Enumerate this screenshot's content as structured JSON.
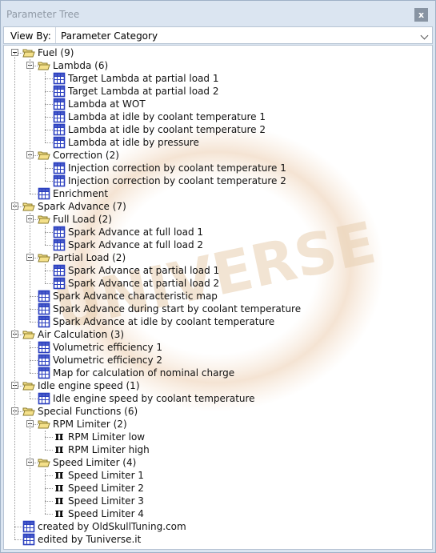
{
  "panel": {
    "title": "Parameter Tree",
    "close_label": "x"
  },
  "view_by": {
    "label": "View By:",
    "value": "Parameter Category"
  },
  "watermark_text": "UNIVERSE",
  "tree": [
    {
      "label": "Fuel (9)",
      "icon": "folder-open-icon",
      "expanded": true,
      "children": [
        {
          "label": "Lambda (6)",
          "icon": "folder-open-icon",
          "expanded": true,
          "children": [
            {
              "label": "Target Lambda at partial load 1",
              "icon": "table-icon"
            },
            {
              "label": "Target Lambda at partial load 2",
              "icon": "table-icon"
            },
            {
              "label": "Lambda at WOT",
              "icon": "table-icon"
            },
            {
              "label": "Lambda at idle by coolant temperature 1",
              "icon": "table-icon"
            },
            {
              "label": "Lambda at idle by coolant temperature 2",
              "icon": "table-icon"
            },
            {
              "label": "Lambda at idle by pressure",
              "icon": "table-icon"
            }
          ]
        },
        {
          "label": "Correction (2)",
          "icon": "folder-open-icon",
          "expanded": true,
          "children": [
            {
              "label": "Injection correction by coolant temperature 1",
              "icon": "table-icon"
            },
            {
              "label": "Injection correction by coolant temperature 2",
              "icon": "table-icon"
            }
          ]
        },
        {
          "label": "Enrichment",
          "icon": "table-icon"
        }
      ]
    },
    {
      "label": "Spark Advance (7)",
      "icon": "folder-open-icon",
      "expanded": true,
      "children": [
        {
          "label": "Full Load (2)",
          "icon": "folder-open-icon",
          "expanded": true,
          "children": [
            {
              "label": "Spark Advance at full load 1",
              "icon": "table-icon"
            },
            {
              "label": "Spark Advance at full load 2",
              "icon": "table-icon"
            }
          ]
        },
        {
          "label": "Partial Load (2)",
          "icon": "folder-open-icon",
          "expanded": true,
          "children": [
            {
              "label": "Spark Advance at partial load 1",
              "icon": "table-icon"
            },
            {
              "label": "Spark Advance at partial load 2",
              "icon": "table-icon"
            }
          ]
        },
        {
          "label": "Spark Advance characteristic map",
          "icon": "table-icon"
        },
        {
          "label": "Spark Advance during start by coolant temperature",
          "icon": "table-icon"
        },
        {
          "label": "Spark Advance at idle by coolant temperature",
          "icon": "table-icon"
        }
      ]
    },
    {
      "label": "Air Calculation (3)",
      "icon": "folder-open-icon",
      "expanded": true,
      "children": [
        {
          "label": "Volumetric efficiency 1",
          "icon": "table-icon"
        },
        {
          "label": "Volumetric efficiency 2",
          "icon": "table-icon"
        },
        {
          "label": "Map for calculation of nominal charge",
          "icon": "table-icon"
        }
      ]
    },
    {
      "label": "Idle engine speed (1)",
      "icon": "folder-open-icon",
      "expanded": true,
      "children": [
        {
          "label": "Idle engine speed by coolant temperature",
          "icon": "table-icon"
        }
      ]
    },
    {
      "label": "Special Functions (6)",
      "icon": "folder-open-icon",
      "expanded": true,
      "children": [
        {
          "label": "RPM Limiter (2)",
          "icon": "folder-open-icon",
          "expanded": true,
          "children": [
            {
              "label": "RPM Limiter low",
              "icon": "pi-icon"
            },
            {
              "label": "RPM Limiter high",
              "icon": "pi-icon"
            }
          ]
        },
        {
          "label": "Speed Limiter (4)",
          "icon": "folder-open-icon",
          "expanded": true,
          "children": [
            {
              "label": "Speed Limiter 1",
              "icon": "pi-icon"
            },
            {
              "label": "Speed Limiter 2",
              "icon": "pi-icon"
            },
            {
              "label": "Speed Limiter 3",
              "icon": "pi-icon"
            },
            {
              "label": "Speed Limiter 4",
              "icon": "pi-icon"
            }
          ]
        }
      ]
    },
    {
      "label": "created by OldSkullTuning.com",
      "icon": "table-icon"
    },
    {
      "label": "edited by Tuniverse.it",
      "icon": "table-icon"
    }
  ],
  "colors": {
    "panel_bg": "#dbe5f1",
    "folder_fill": "#f4e08a",
    "folder_edge": "#8a7a2a",
    "table_blue": "#2a3fbf",
    "watermark": "#e8c9a8"
  }
}
